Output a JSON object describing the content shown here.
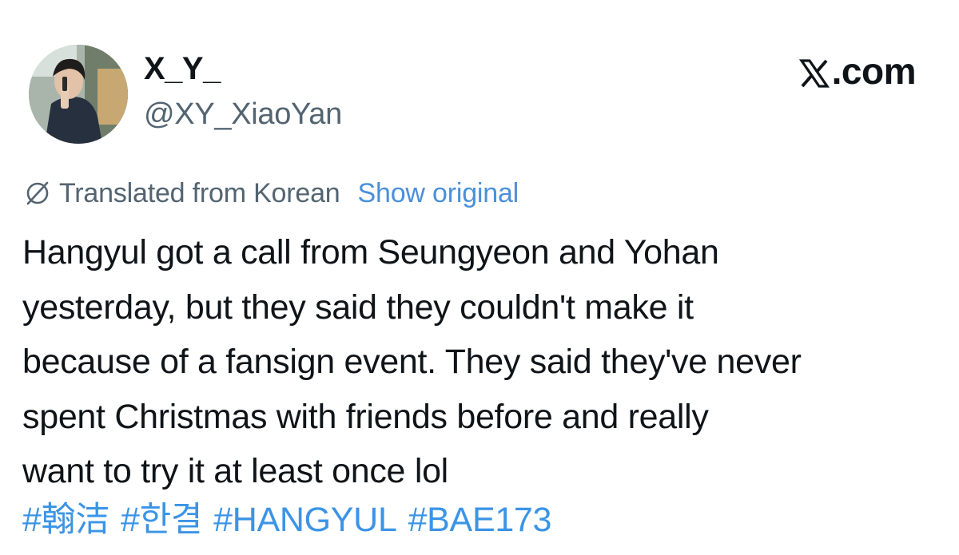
{
  "author": {
    "display_name": "X_Y_",
    "handle": "@XY_XiaoYan"
  },
  "brand": {
    "label": ".com",
    "icon": "x-logo-icon"
  },
  "translation": {
    "icon": "globe-slash-icon",
    "label": "Translated from Korean",
    "show_original": "Show original"
  },
  "tweet": {
    "lines": [
      "Hangyul got a call from Seungyeon and Yohan",
      "yesterday, but they said they couldn't make it",
      "because of a fansign event. They said they've never",
      "spent Christmas with friends before and really",
      "want to try it at least once lol"
    ]
  },
  "hashtags": [
    "#翰洁",
    "#한결",
    "#HANGYUL",
    "#BAE173"
  ],
  "colors": {
    "text": "#0f1419",
    "secondary": "#536471",
    "link": "#3b94e6"
  }
}
